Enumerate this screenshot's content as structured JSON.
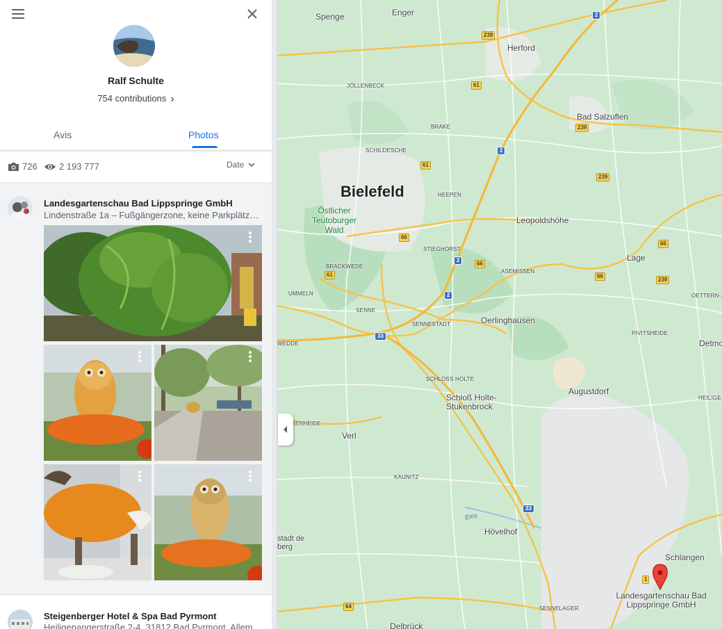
{
  "panel": {
    "menu_icon": "hamburger-menu-icon",
    "close_icon": "close-icon",
    "profile": {
      "name": "Ralf Schulte",
      "contributions": "754 contributions",
      "contributions_chevron": "›"
    },
    "tabs": [
      {
        "label": "Avis",
        "active": false
      },
      {
        "label": "Photos",
        "active": true
      }
    ],
    "accent_color": "#1a73e8",
    "stats": {
      "photos_count": "726",
      "views_count": "2 193 777",
      "sort_label": "Date"
    },
    "places": [
      {
        "name": "Landesgartenschau Bad Lippspringe GmbH",
        "address": "Lindenstraße 1a – Fußgängerzone, keine Parkplätze, ..."
      },
      {
        "name": "Steigenberger Hotel & Spa Bad Pyrmont",
        "address": "Heiligenangerstraße 2-4, 31812 Bad Pyrmont, Allema..."
      }
    ]
  },
  "map": {
    "labels": {
      "spenge": "Spenge",
      "enger": "Enger",
      "herford": "Herford",
      "jollenbeck": "JÖLLENBECK",
      "bad_salzuflen": "Bad Salzuflen",
      "brake": "BRAKE",
      "schildesche": "SCHILDESCHE",
      "bielefeld": "Bielefeld",
      "heepen": "HEEPEN",
      "teutoburger": "Östlicher Teutoburger Wald",
      "leopoldshohe": "Leopoldshöhe",
      "stieghorst": "STIEGHORST",
      "brackwede": "BRACKWEDE",
      "asemissen": "ASEMISSEN",
      "lage": "Lage",
      "ummeln": "UMMELN",
      "oettern": "OETTERN-...",
      "senne": "SENNE",
      "sennestadt": "SENNESTADT",
      "oerlinghausen": "Oerlinghausen",
      "pivitsheide": "PIVITSHEIDE",
      "detmold": "Detmo",
      "wedde": "WEDDE",
      "schloss_holte": "SCHLOSS HOLTE",
      "augustdorf": "Augustdorf",
      "holte_stukenbrock": "Schloß Holte-Stukenbrock",
      "heilige": "HEILIGE",
      "renheide": "RENHEIDE",
      "verl": "Verl",
      "kaunitz": "KAUNITZ",
      "ems": "Ems",
      "hovelhof": "Hövelhof",
      "stadt_de": "stadt de",
      "berg": "berg",
      "schlangen": "Schlangen",
      "sennelager": "SENNELAGER",
      "delbruck": "Delbrück",
      "marker": "Landesgartenschau Bad Lippspringe GmbH"
    },
    "shields": {
      "a2": "2",
      "b239": "239",
      "b61": "61",
      "b66": "66",
      "a33": "33",
      "b64": "64",
      "b1": "1"
    },
    "marker_color": "#ea4335",
    "road_color": "#f6c244"
  }
}
